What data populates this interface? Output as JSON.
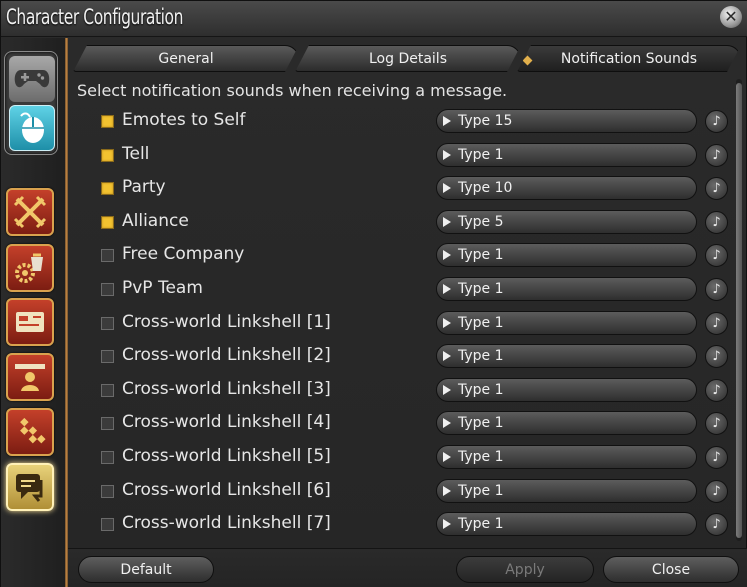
{
  "window": {
    "title": "Character Configuration"
  },
  "tabs": [
    {
      "label": "General"
    },
    {
      "label": "Log Details"
    },
    {
      "label": "Notification Sounds"
    }
  ],
  "instruction": "Select notification sounds when receiving a message.",
  "rows": [
    {
      "label": "Emotes to Self",
      "checked": true,
      "sound": "Type 15"
    },
    {
      "label": "Tell",
      "checked": true,
      "sound": "Type 1"
    },
    {
      "label": "Party",
      "checked": true,
      "sound": "Type 10"
    },
    {
      "label": "Alliance",
      "checked": true,
      "sound": "Type 5"
    },
    {
      "label": "Free Company",
      "checked": false,
      "sound": "Type 1"
    },
    {
      "label": "PvP Team",
      "checked": false,
      "sound": "Type 1"
    },
    {
      "label": "Cross-world Linkshell [1]",
      "checked": false,
      "sound": "Type 1"
    },
    {
      "label": "Cross-world Linkshell [2]",
      "checked": false,
      "sound": "Type 1"
    },
    {
      "label": "Cross-world Linkshell [3]",
      "checked": false,
      "sound": "Type 1"
    },
    {
      "label": "Cross-world Linkshell [4]",
      "checked": false,
      "sound": "Type 1"
    },
    {
      "label": "Cross-world Linkshell [5]",
      "checked": false,
      "sound": "Type 1"
    },
    {
      "label": "Cross-world Linkshell [6]",
      "checked": false,
      "sound": "Type 1"
    },
    {
      "label": "Cross-world Linkshell [7]",
      "checked": false,
      "sound": "Type 1"
    }
  ],
  "buttons": {
    "default": "Default",
    "apply": "Apply",
    "close": "Close"
  },
  "icons": {
    "window_close": "close-icon",
    "mode_gamepad": "gamepad-icon",
    "mode_mouse": "mouse-icon",
    "categories": [
      "crossed-swords-icon",
      "gear-pouch-icon",
      "card-icon",
      "character-card-icon",
      "checkered-icon",
      "speech-bubbles-icon"
    ],
    "play": "music-note-icon"
  },
  "colors": {
    "accent": "#e2b04c",
    "checked": "#f2c230",
    "category": "#c4402a",
    "category_active": "#e8d27a",
    "mouse_mode": "#5fd2e6"
  }
}
